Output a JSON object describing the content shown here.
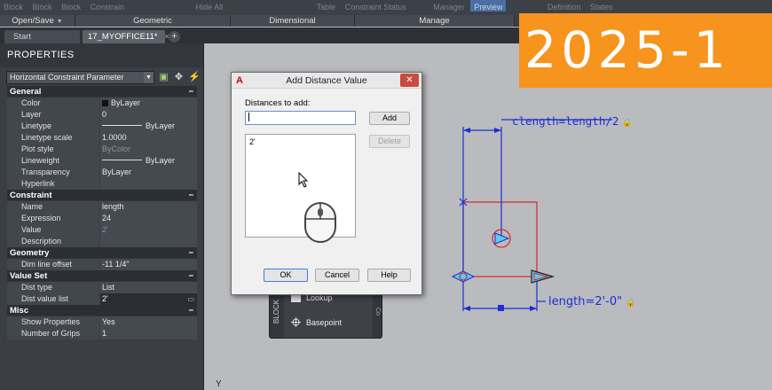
{
  "ribbon": {
    "tool_labels": [
      "Block",
      "Block",
      "Block",
      "Constrain",
      "Hide All",
      "Table",
      "Constraint Status",
      "Manager",
      "Preview",
      "Definition",
      "States"
    ],
    "panels": [
      {
        "label": "Open/Save",
        "has_arrow": true
      },
      {
        "label": "Geometric",
        "has_arrow": false
      },
      {
        "label": "Dimensional",
        "has_arrow": false
      },
      {
        "label": "Manage",
        "has_arrow": false
      }
    ]
  },
  "tabs": {
    "start": "Start",
    "active": "17_MYOFFICE11*",
    "close_glyph": "×",
    "add_glyph": "+"
  },
  "properties": {
    "title": "PROPERTIES",
    "selection": "Horizontal Constraint Parameter",
    "categories": {
      "general": {
        "label": "General",
        "rows": {
          "color": {
            "k": "Color",
            "v": "ByLayer"
          },
          "layer": {
            "k": "Layer",
            "v": "0"
          },
          "linetype": {
            "k": "Linetype",
            "v": "ByLayer"
          },
          "linetype_scale": {
            "k": "Linetype scale",
            "v": "1.0000"
          },
          "plot_style": {
            "k": "Plot style",
            "v": "ByColor"
          },
          "lineweight": {
            "k": "Lineweight",
            "v": "ByLayer"
          },
          "transparency": {
            "k": "Transparency",
            "v": "ByLayer"
          },
          "hyperlink": {
            "k": "Hyperlink",
            "v": ""
          }
        }
      },
      "constraint": {
        "label": "Constraint",
        "rows": {
          "name": {
            "k": "Name",
            "v": "length"
          },
          "expression": {
            "k": "Expression",
            "v": "24"
          },
          "value": {
            "k": "Value",
            "v": "2'"
          },
          "description": {
            "k": "Description",
            "v": ""
          }
        }
      },
      "geometry": {
        "label": "Geometry",
        "rows": {
          "dim_line_offset": {
            "k": "Dim line offset",
            "v": "-11 1/4\""
          }
        }
      },
      "value_set": {
        "label": "Value Set",
        "rows": {
          "dist_type": {
            "k": "Dist type",
            "v": "List"
          },
          "dist_value_list": {
            "k": "Dist value list",
            "v": "2'"
          }
        }
      },
      "misc": {
        "label": "Misc",
        "rows": {
          "show_properties": {
            "k": "Show Properties",
            "v": "Yes"
          },
          "number_of_grips": {
            "k": "Number of Grips",
            "v": "1"
          }
        }
      }
    },
    "collapse_glyph": "−",
    "more_glyph": "▭"
  },
  "block_panel": {
    "side_label": "BLOCK",
    "side_label_right": "Co",
    "items": {
      "lookup": "Lookup",
      "basepoint": "Basepoint"
    }
  },
  "dialog": {
    "title": "Add Distance Value",
    "logo": "A",
    "close_glyph": "✕",
    "distances_label": "Distances to add:",
    "distances_input_value": "",
    "add_label": "Add",
    "delete_label": "Delete",
    "list_items": [
      "2'"
    ],
    "ok_label": "OK",
    "cancel_label": "Cancel",
    "help_label": "Help"
  },
  "drawing": {
    "param_top": "clength=length/2",
    "param_bottom": "length=2'-0\"",
    "lock_glyph": "🔒",
    "ucs_label": "Y",
    "colors": {
      "constraint_blue": "#1a2fd6",
      "geometry_red": "#d9262a",
      "grip_cyan": "#5ec9f0"
    }
  },
  "badge": {
    "text": "2025-1",
    "color": "#f7941d"
  }
}
